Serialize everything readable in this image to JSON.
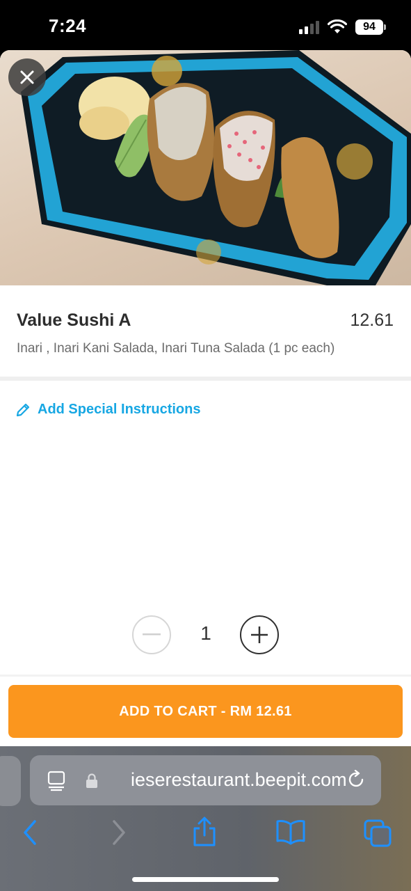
{
  "status_bar": {
    "time": "7:24",
    "battery": "94",
    "icons": [
      "signal-icon",
      "wifi-icon",
      "battery-icon"
    ]
  },
  "product": {
    "name": "Value Sushi A",
    "price": "12.61",
    "description": "Inari , Inari Kani Salada, Inari Tuna Salada (1 pc each)",
    "image_alt": "sushi-platter-image"
  },
  "instructions": {
    "label": "Add Special Instructions",
    "icon": "pencil-icon"
  },
  "quantity": {
    "value": "1",
    "icons": [
      "minus-icon",
      "plus-icon"
    ]
  },
  "cart": {
    "label": "ADD TO CART - RM 12.61"
  },
  "browser": {
    "url": "ieserestaurant.beepit.com",
    "icons": [
      "reader-icon",
      "lock-icon",
      "reload-icon",
      "back-icon",
      "forward-icon",
      "share-icon",
      "bookmarks-icon",
      "tabs-icon"
    ]
  },
  "colors": {
    "accent_blue": "#17a7e3",
    "cart_orange": "#fb961e",
    "text_dark": "#2d2d2d"
  }
}
